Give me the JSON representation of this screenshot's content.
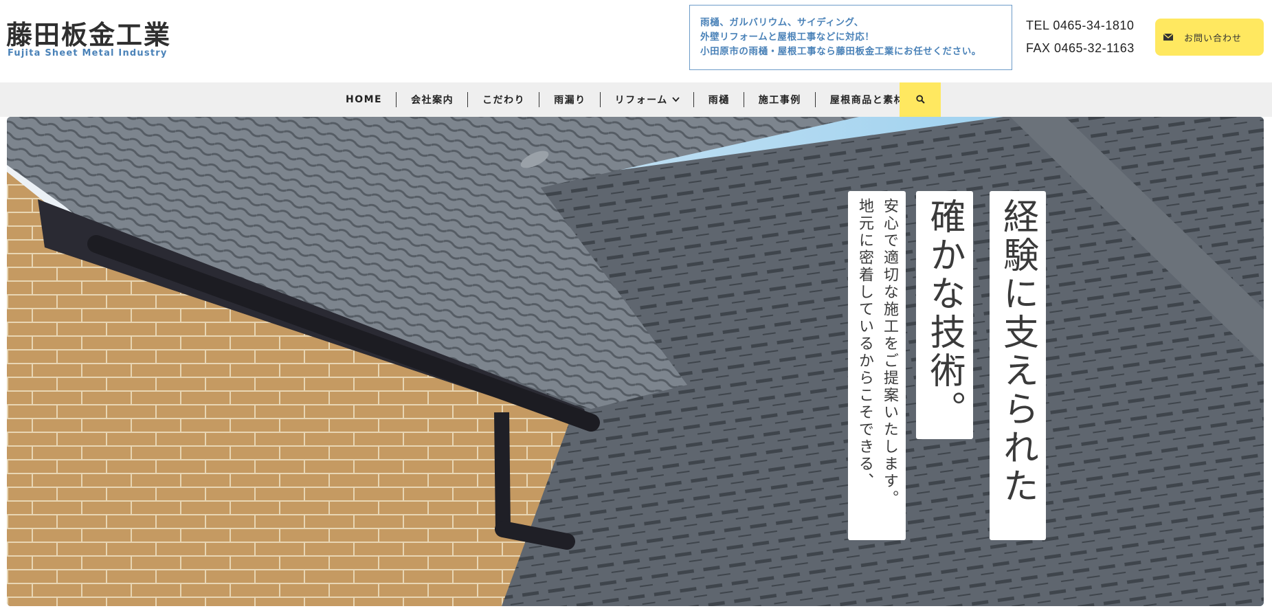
{
  "header": {
    "logo_title": "藤田板金工業",
    "logo_subtitle": "Fujita Sheet Metal Industry",
    "notice_lines": [
      "雨樋、ガルバリウム、サイディング、",
      "外壁リフォームと屋根工事などに対応！",
      "小田原市の雨樋・屋根工事なら藤田板金工業にお任せください。"
    ],
    "tel": "TEL 0465-34-1810",
    "fax": "FAX 0465-32-1163",
    "contact_label": "お問い合わせ",
    "contact_icon": "mail-icon"
  },
  "nav": {
    "items": [
      {
        "label": "HOME"
      },
      {
        "label": "会社案内"
      },
      {
        "label": "こだわり"
      },
      {
        "label": "雨漏り"
      },
      {
        "label": "リフォーム"
      },
      {
        "label": "雨樋"
      },
      {
        "label": "施工事例"
      },
      {
        "label": "屋根商品と素材"
      }
    ],
    "search_icon": "search-icon"
  },
  "hero": {
    "headline_1": "経験に支えられた",
    "headline_2": "確かな技術。",
    "body_col_1": "地元に密着しているからこそできる、",
    "body_col_2": "安心で適切な施工をご提案いたします。"
  },
  "colors": {
    "accent_yellow": "#ffe860",
    "brand_blue": "#4a82b8",
    "nav_bg": "#efefef"
  }
}
